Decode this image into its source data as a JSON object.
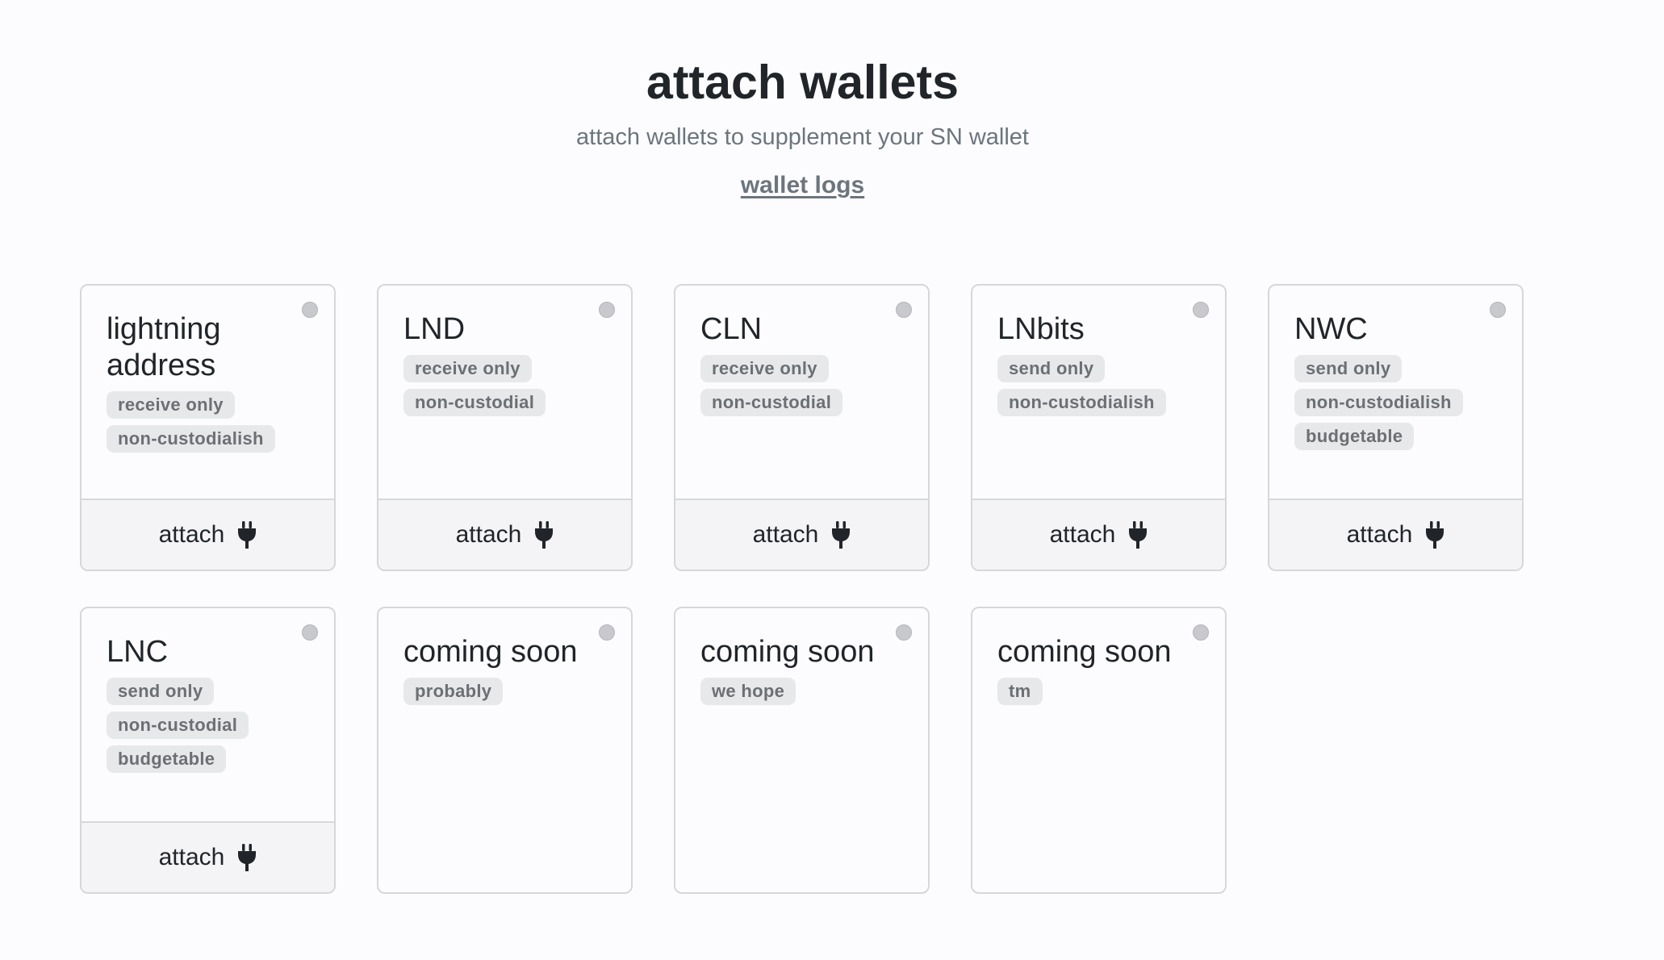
{
  "header": {
    "title": "attach wallets",
    "subtitle": "attach wallets to supplement your SN wallet",
    "logs_link": "wallet logs"
  },
  "attach_label": "attach",
  "icons": {
    "status": "status-dot-icon",
    "attach": "plug-icon"
  },
  "colors": {
    "status_inactive": "#c8c9cc",
    "badge_bg": "#e7e8ea",
    "footer_bg": "#f4f4f6"
  },
  "wallets": [
    {
      "title": "lightning address",
      "badges": [
        "receive only",
        "non-custodialish"
      ]
    },
    {
      "title": "LND",
      "badges": [
        "receive only",
        "non-custodial"
      ]
    },
    {
      "title": "CLN",
      "badges": [
        "receive only",
        "non-custodial"
      ]
    },
    {
      "title": "LNbits",
      "badges": [
        "send only",
        "non-custodialish"
      ]
    },
    {
      "title": "NWC",
      "badges": [
        "send only",
        "non-custodialish",
        "budgetable"
      ]
    },
    {
      "title": "LNC",
      "badges": [
        "send only",
        "non-custodial",
        "budgetable"
      ]
    },
    {
      "title": "coming soon",
      "badges": [
        "probably"
      ]
    },
    {
      "title": "coming soon",
      "badges": [
        "we hope"
      ]
    },
    {
      "title": "coming soon",
      "badges": [
        "tm"
      ]
    }
  ]
}
